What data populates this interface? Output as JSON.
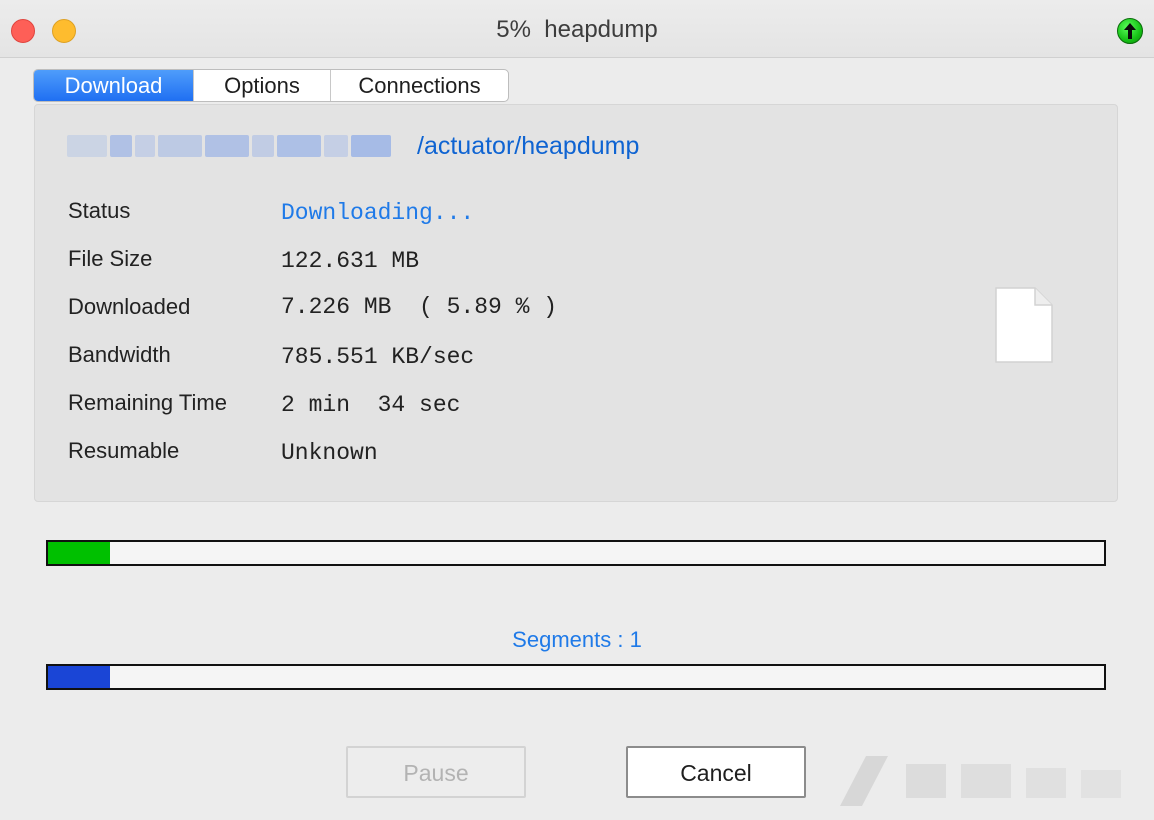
{
  "window": {
    "title": "5%  heapdump"
  },
  "tabs": [
    {
      "label": "Download",
      "active": true
    },
    {
      "label": "Options",
      "active": false
    },
    {
      "label": "Connections",
      "active": false
    }
  ],
  "download": {
    "url_suffix": "/actuator/heapdump",
    "rows": [
      {
        "label": "Status",
        "value": "Downloading..."
      },
      {
        "label": "File Size",
        "value": "122.631 MB"
      },
      {
        "label": "Downloaded",
        "value": "7.226 MB  ( 5.89 % )"
      },
      {
        "label": "Bandwidth",
        "value": "785.551 KB/sec"
      },
      {
        "label": "Remaining Time",
        "value": "2 min  34 sec"
      },
      {
        "label": "Resumable",
        "value": "Unknown"
      }
    ]
  },
  "progress": {
    "overall_fraction": 0.0589,
    "segment_fraction": 0.0589,
    "segments_label": "Segments : 1"
  },
  "buttons": {
    "pause_label": "Pause",
    "pause_enabled": false,
    "cancel_label": "Cancel"
  },
  "colors": {
    "accent": "#1f7ae8",
    "url": "#0f64d2",
    "progress_main": "#00c000",
    "progress_segment": "#1a45d6",
    "tab_active": "#1f6ff2"
  },
  "icons": {
    "titlebar_status": "green-up-arrow-icon",
    "file": "document-icon"
  }
}
